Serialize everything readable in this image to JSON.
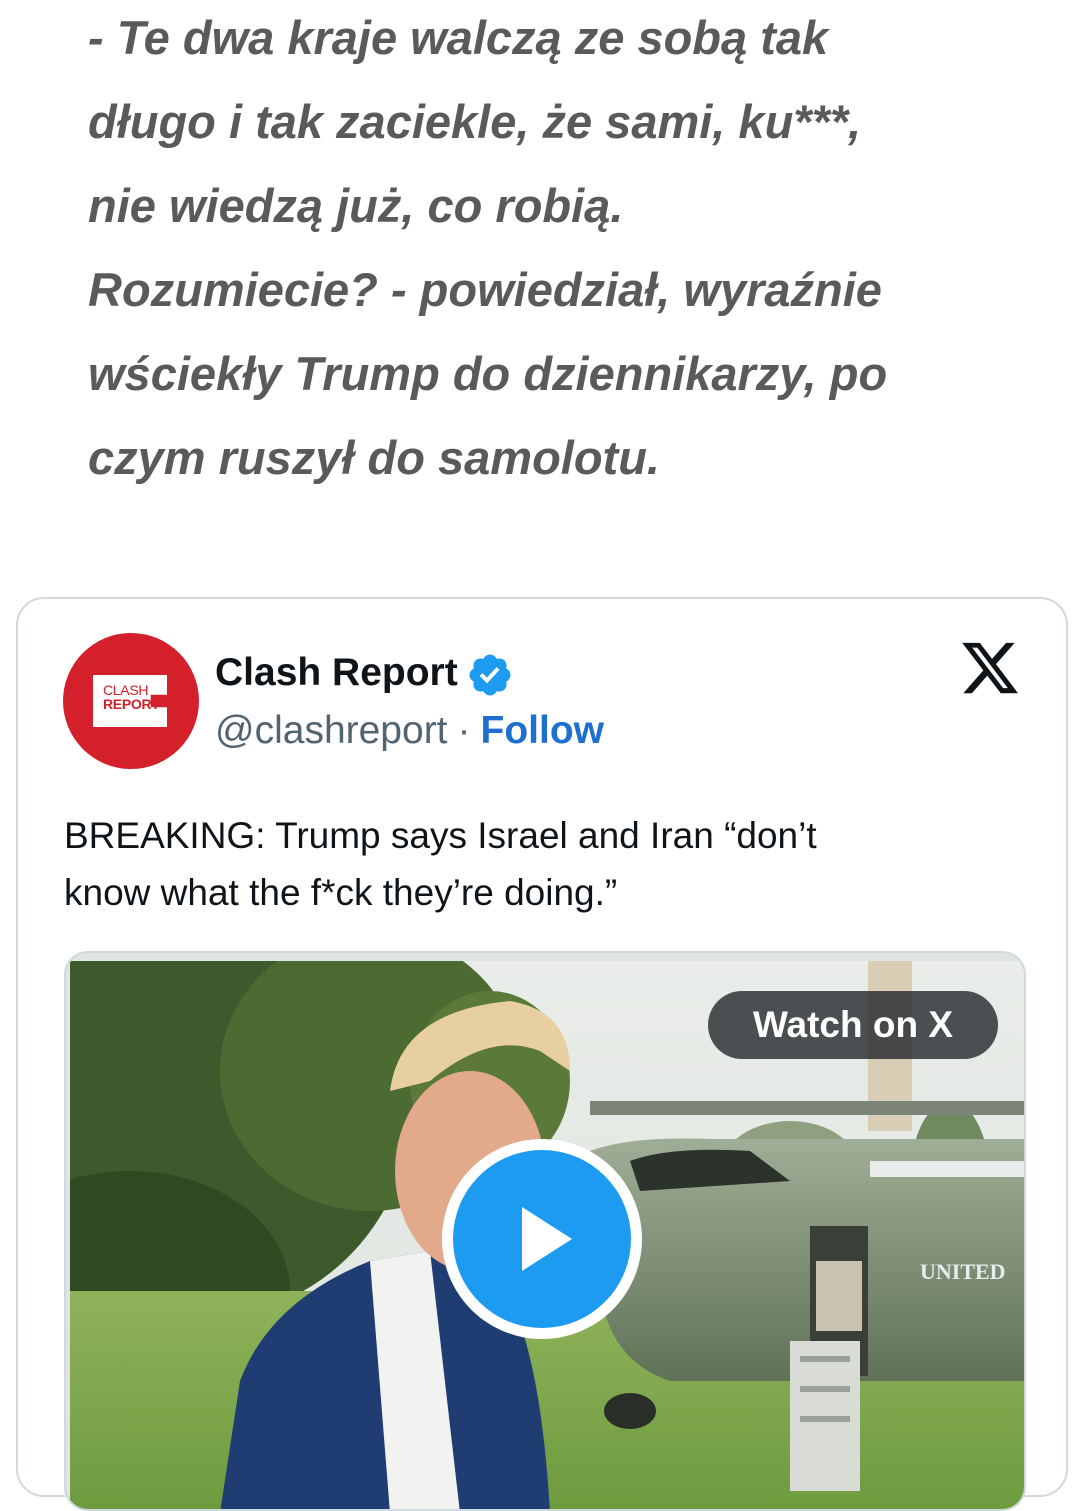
{
  "article": {
    "quote_lines": [
      "- Te dwa kraje walczą ze sobą tak",
      "długo i tak zaciekle, że sami, ku***,",
      "nie wiedzą już, co robią.",
      "Rozumiecie? - powiedział, wyraźnie",
      "wściekły Trump do dziennikarzy, po",
      "czym ruszył do samolotu."
    ]
  },
  "embed": {
    "avatar": {
      "line1": "CLASH",
      "line2": "REPORT",
      "color": "#d4202a"
    },
    "author_name": "Clash Report",
    "handle": "@clashreport",
    "separator": "·",
    "follow_label": "Follow",
    "verified_icon": "verified-badge-icon",
    "platform_icon": "x-logo-icon",
    "tweet_lines": [
      "BREAKING: Trump says Israel and Iran “don’t",
      "know what the f*ck they’re doing.”"
    ],
    "media": {
      "watch_label": "Watch on X",
      "play_icon": "play-icon",
      "helicopter_text": "UNITED"
    }
  },
  "colors": {
    "quote_text": "#5a5a5a",
    "link": "#1d6fd0",
    "verified": "#1d9bf0",
    "play": "#1d9bf0",
    "border": "#cfd9de"
  }
}
